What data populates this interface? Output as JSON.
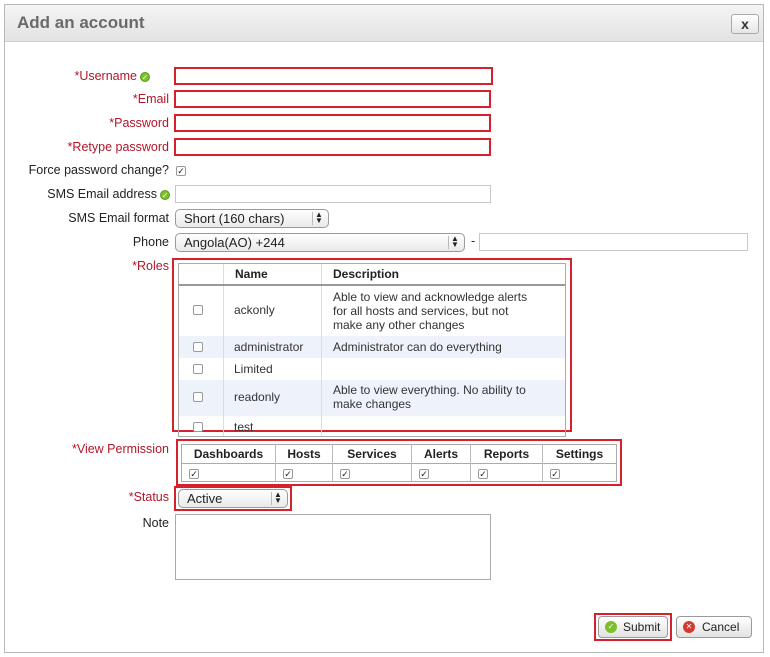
{
  "dialog": {
    "title": "Add an account",
    "close_label": "x"
  },
  "form": {
    "username": {
      "asterisk": "*",
      "label": "Username",
      "value": ""
    },
    "email": {
      "asterisk": "*",
      "label": "Email",
      "value": ""
    },
    "password": {
      "asterisk": "*",
      "label": "Password",
      "value": ""
    },
    "retype_password": {
      "asterisk": "*",
      "label": "Retype password",
      "value": ""
    },
    "force_password_change": {
      "label": "Force password change?",
      "checked": true
    },
    "sms_email_address": {
      "label": "SMS Email address",
      "value": ""
    },
    "sms_email_format": {
      "label": "SMS Email format",
      "selected": "Short (160 chars)"
    },
    "phone": {
      "label": "Phone",
      "country_selected": "Angola(AO) +244",
      "separator": "-",
      "number": ""
    },
    "roles": {
      "asterisk": "*",
      "label": "Roles",
      "columns": [
        "Name",
        "Description"
      ],
      "rows": [
        {
          "name": "ackonly",
          "desc": [
            "Able to view and acknowledge alerts",
            "for all hosts and services, but not",
            "make any other changes"
          ],
          "checked": false
        },
        {
          "name": "administrator",
          "desc": [
            "Administrator can do everything"
          ],
          "checked": false
        },
        {
          "name": "Limited",
          "desc": [],
          "checked": false
        },
        {
          "name": "readonly",
          "desc": [
            "Able to view everything. No ability to",
            "make changes"
          ],
          "checked": false
        },
        {
          "name": "test",
          "desc": [],
          "checked": false
        }
      ]
    },
    "view_permission": {
      "asterisk": "*",
      "label": "View Permission",
      "columns": [
        "Dashboards",
        "Hosts",
        "Services",
        "Alerts",
        "Reports",
        "Settings"
      ],
      "checked": [
        true,
        true,
        true,
        true,
        true,
        true
      ]
    },
    "status": {
      "asterisk": "*",
      "label": "Status",
      "selected": "Active"
    },
    "note": {
      "label": "Note",
      "value": ""
    }
  },
  "buttons": {
    "submit": "Submit",
    "cancel": "Cancel"
  },
  "colors": {
    "highlight": "#d6212c",
    "required": "#b0172a",
    "ok_green": "#7bbf2a",
    "cancel_red": "#d23a2f"
  }
}
